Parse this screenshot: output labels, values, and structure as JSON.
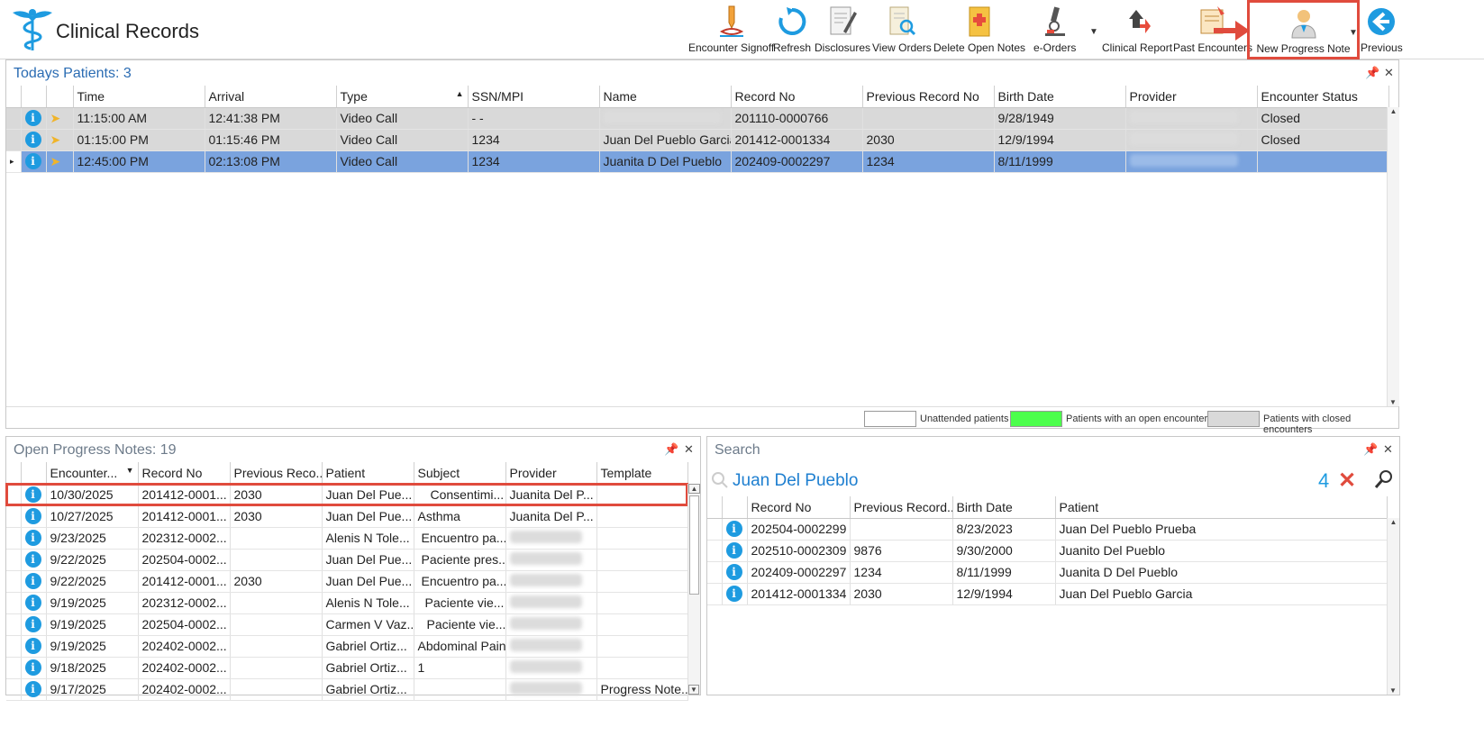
{
  "app": {
    "title": "Clinical Records"
  },
  "toolbar": {
    "encounter_signoff": "Encounter Signoff",
    "refresh": "Refresh",
    "disclosures": "Disclosures",
    "view_orders": "View Orders",
    "delete_open_notes": "Delete Open Notes",
    "e_orders": "e-Orders",
    "clinical_report": "Clinical Report",
    "past_encounters": "Past Encounters",
    "new_progress_note": "New Progress Note",
    "previous": "Previous"
  },
  "todays_patients": {
    "title": "Todays Patients:",
    "count": "3",
    "columns": [
      "Time",
      "Arrival",
      "Type",
      "SSN/MPI",
      "Name",
      "Record No",
      "Previous Record No",
      "Birth Date",
      "Provider",
      "Encounter Status"
    ],
    "rows": [
      {
        "time": "11:15:00 AM",
        "arrival": "12:41:38 PM",
        "type": "Video Call",
        "ssn": "- -",
        "name": "",
        "record_no": "201110-0000766",
        "prev_record_no": "",
        "birth_date": "9/28/1949",
        "provider": "",
        "status": "Closed"
      },
      {
        "time": "01:15:00 PM",
        "arrival": "01:15:46 PM",
        "type": "Video Call",
        "ssn": "1234",
        "name": "Juan Del Pueblo Garcia",
        "record_no": "201412-0001334",
        "prev_record_no": "2030",
        "birth_date": "12/9/1994",
        "provider": "",
        "status": "Closed"
      },
      {
        "time": "12:45:00 PM",
        "arrival": "02:13:08 PM",
        "type": "Video Call",
        "ssn": "1234",
        "name": "Juanita D Del Pueblo",
        "record_no": "202409-0002297",
        "prev_record_no": "1234",
        "birth_date": "8/11/1999",
        "provider": "",
        "status": ""
      }
    ],
    "legend": {
      "unattended": "Unattended patients",
      "open": "Patients with an open encounter",
      "closed": "Patients with closed encounters"
    }
  },
  "open_notes": {
    "title": "Open Progress Notes:",
    "count": "19",
    "columns": [
      "Encounter...",
      "Record No",
      "Previous Reco...",
      "Patient",
      "Subject",
      "Provider",
      "Template"
    ],
    "rows": [
      {
        "date": "10/30/2025",
        "record_no": "201412-0001...",
        "prev": "2030",
        "patient": "Juan Del Pue...",
        "subject": "Consentimi...",
        "provider": "Juanita Del P...",
        "template": ""
      },
      {
        "date": "10/27/2025",
        "record_no": "201412-0001...",
        "prev": "2030",
        "patient": "Juan Del Pue...",
        "subject": "Asthma",
        "provider": "Juanita Del P...",
        "template": ""
      },
      {
        "date": "9/23/2025",
        "record_no": "202312-0002...",
        "prev": "",
        "patient": "Alenis N Tole...",
        "subject": "Encuentro pa...",
        "provider": "",
        "template": ""
      },
      {
        "date": "9/22/2025",
        "record_no": "202504-0002...",
        "prev": "",
        "patient": "Juan Del Pue...",
        "subject": "Paciente pres...",
        "provider": "",
        "template": ""
      },
      {
        "date": "9/22/2025",
        "record_no": "201412-0001...",
        "prev": "2030",
        "patient": "Juan Del Pue...",
        "subject": "Encuentro pa...",
        "provider": "",
        "template": ""
      },
      {
        "date": "9/19/2025",
        "record_no": "202312-0002...",
        "prev": "",
        "patient": "Alenis N Tole...",
        "subject": "Paciente vie...",
        "provider": "",
        "template": ""
      },
      {
        "date": "9/19/2025",
        "record_no": "202504-0002...",
        "prev": "",
        "patient": "Carmen V Vaz...",
        "subject": "Paciente vie...",
        "provider": "",
        "template": ""
      },
      {
        "date": "9/19/2025",
        "record_no": "202402-0002...",
        "prev": "",
        "patient": "Gabriel Ortiz...",
        "subject": "Abdominal Pain",
        "provider": "",
        "template": ""
      },
      {
        "date": "9/18/2025",
        "record_no": "202402-0002...",
        "prev": "",
        "patient": "Gabriel Ortiz...",
        "subject": "1",
        "provider": "",
        "template": ""
      },
      {
        "date": "9/17/2025",
        "record_no": "202402-0002...",
        "prev": "",
        "patient": "Gabriel Ortiz...",
        "subject": "",
        "provider": "",
        "template": "Progress Note..."
      }
    ]
  },
  "search": {
    "title": "Search",
    "query": "Juan Del Pueblo",
    "result_count": "4",
    "columns": [
      "Record No",
      "Previous Record...",
      "Birth Date",
      "Patient"
    ],
    "rows": [
      {
        "record_no": "202504-0002299",
        "prev": "",
        "birth_date": "8/23/2023",
        "patient": "Juan Del Pueblo Prueba"
      },
      {
        "record_no": "202510-0002309",
        "prev": "9876",
        "birth_date": "9/30/2000",
        "patient": "Juanito Del Pueblo"
      },
      {
        "record_no": "202409-0002297",
        "prev": "1234",
        "birth_date": "8/11/1999",
        "patient": "Juanita D Del Pueblo"
      },
      {
        "record_no": "201412-0001334",
        "prev": "2030",
        "birth_date": "12/9/1994",
        "patient": "Juan Del Pueblo Garcia"
      }
    ]
  },
  "colors": {
    "accent": "#2b6cb3",
    "selected_row": "#7aa3de",
    "closed_row": "#d9d9d9",
    "open_encounter": "#4cff4c",
    "highlight_red": "#e04b3d"
  }
}
